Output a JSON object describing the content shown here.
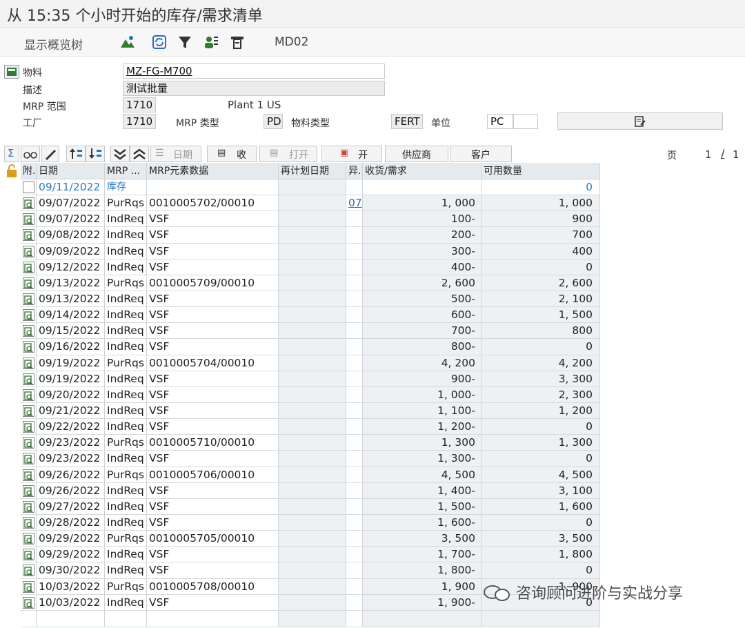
{
  "window": {
    "title": "从 15:35 个小时开始的库存/需求清单"
  },
  "toolbar": {
    "overview_tree": "显示概览树",
    "transaction": "MD02"
  },
  "header": {
    "material_label": "物料",
    "material_value": "MZ-FG-M700",
    "desc_label": "描述",
    "desc_value": "测试批量",
    "mrp_area_label": "MRP 范围",
    "mrp_area_value": "1710",
    "mrp_area_text": "Plant 1 US",
    "plant_label": "工厂",
    "plant_value": "1710",
    "mrp_type_label": "MRP 类型",
    "mrp_type_value": "PD",
    "mat_type_label": "物料类型",
    "mat_type_value": "FERT",
    "unit_label": "单位",
    "unit_value": "PC"
  },
  "grid_toolbar": {
    "sum": "Σ",
    "date_btn": "日期",
    "recv_btn": "收",
    "open_btn": "打开",
    "open2_btn": "开",
    "vendor_btn": "供应商",
    "customer_btn": "客户",
    "page_label": "页",
    "page_current": "1",
    "page_sep": "/",
    "page_total": "1"
  },
  "columns": {
    "attach": "附.",
    "date": "日期",
    "mrp": "MRP ...",
    "element": "MRP元素数据",
    "resched": "再计划日期",
    "exc": "异.",
    "recv": "收货/需求",
    "avail": "可用数量"
  },
  "stock_row": {
    "date": "09/11/2022",
    "mrp": "库存",
    "avail": "0"
  },
  "rows": [
    {
      "date": "09/07/2022",
      "mrp": "PurRqs",
      "element": "0010005702/00010",
      "exc": "07",
      "recv": "1, 000",
      "avail": "1, 000"
    },
    {
      "date": "09/07/2022",
      "mrp": "IndReq",
      "element": "VSF",
      "exc": "",
      "recv": "100-",
      "avail": "900"
    },
    {
      "date": "09/08/2022",
      "mrp": "IndReq",
      "element": "VSF",
      "exc": "",
      "recv": "200-",
      "avail": "700"
    },
    {
      "date": "09/09/2022",
      "mrp": "IndReq",
      "element": "VSF",
      "exc": "",
      "recv": "300-",
      "avail": "400"
    },
    {
      "date": "09/12/2022",
      "mrp": "IndReq",
      "element": "VSF",
      "exc": "",
      "recv": "400-",
      "avail": "0"
    },
    {
      "date": "09/13/2022",
      "mrp": "PurRqs",
      "element": "0010005709/00010",
      "exc": "",
      "recv": "2, 600",
      "avail": "2, 600"
    },
    {
      "date": "09/13/2022",
      "mrp": "IndReq",
      "element": "VSF",
      "exc": "",
      "recv": "500-",
      "avail": "2, 100"
    },
    {
      "date": "09/14/2022",
      "mrp": "IndReq",
      "element": "VSF",
      "exc": "",
      "recv": "600-",
      "avail": "1, 500"
    },
    {
      "date": "09/15/2022",
      "mrp": "IndReq",
      "element": "VSF",
      "exc": "",
      "recv": "700-",
      "avail": "800"
    },
    {
      "date": "09/16/2022",
      "mrp": "IndReq",
      "element": "VSF",
      "exc": "",
      "recv": "800-",
      "avail": "0"
    },
    {
      "date": "09/19/2022",
      "mrp": "PurRqs",
      "element": "0010005704/00010",
      "exc": "",
      "recv": "4, 200",
      "avail": "4, 200"
    },
    {
      "date": "09/19/2022",
      "mrp": "IndReq",
      "element": "VSF",
      "exc": "",
      "recv": "900-",
      "avail": "3, 300"
    },
    {
      "date": "09/20/2022",
      "mrp": "IndReq",
      "element": "VSF",
      "exc": "",
      "recv": "1, 000-",
      "avail": "2, 300"
    },
    {
      "date": "09/21/2022",
      "mrp": "IndReq",
      "element": "VSF",
      "exc": "",
      "recv": "1, 100-",
      "avail": "1, 200"
    },
    {
      "date": "09/22/2022",
      "mrp": "IndReq",
      "element": "VSF",
      "exc": "",
      "recv": "1, 200-",
      "avail": "0"
    },
    {
      "date": "09/23/2022",
      "mrp": "PurRqs",
      "element": "0010005710/00010",
      "exc": "",
      "recv": "1, 300",
      "avail": "1, 300"
    },
    {
      "date": "09/23/2022",
      "mrp": "IndReq",
      "element": "VSF",
      "exc": "",
      "recv": "1, 300-",
      "avail": "0"
    },
    {
      "date": "09/26/2022",
      "mrp": "PurRqs",
      "element": "0010005706/00010",
      "exc": "",
      "recv": "4, 500",
      "avail": "4, 500"
    },
    {
      "date": "09/26/2022",
      "mrp": "IndReq",
      "element": "VSF",
      "exc": "",
      "recv": "1, 400-",
      "avail": "3, 100"
    },
    {
      "date": "09/27/2022",
      "mrp": "IndReq",
      "element": "VSF",
      "exc": "",
      "recv": "1, 500-",
      "avail": "1, 600"
    },
    {
      "date": "09/28/2022",
      "mrp": "IndReq",
      "element": "VSF",
      "exc": "",
      "recv": "1, 600-",
      "avail": "0"
    },
    {
      "date": "09/29/2022",
      "mrp": "PurRqs",
      "element": "0010005705/00010",
      "exc": "",
      "recv": "3, 500",
      "avail": "3, 500"
    },
    {
      "date": "09/29/2022",
      "mrp": "IndReq",
      "element": "VSF",
      "exc": "",
      "recv": "1, 700-",
      "avail": "1, 800"
    },
    {
      "date": "09/30/2022",
      "mrp": "IndReq",
      "element": "VSF",
      "exc": "",
      "recv": "1, 800-",
      "avail": "0"
    },
    {
      "date": "10/03/2022",
      "mrp": "PurRqs",
      "element": "0010005708/00010",
      "exc": "",
      "recv": "1, 900",
      "avail": "1, 900"
    },
    {
      "date": "10/03/2022",
      "mrp": "IndReq",
      "element": "VSF",
      "exc": "",
      "recv": "1, 900-",
      "avail": "0"
    }
  ],
  "watermark": {
    "text": "咨询顾问进阶与实战分享"
  },
  "colors": {
    "link": "#1a6bbf",
    "stock_date": "#2a79c1",
    "grid_header": "#e5eaee"
  }
}
